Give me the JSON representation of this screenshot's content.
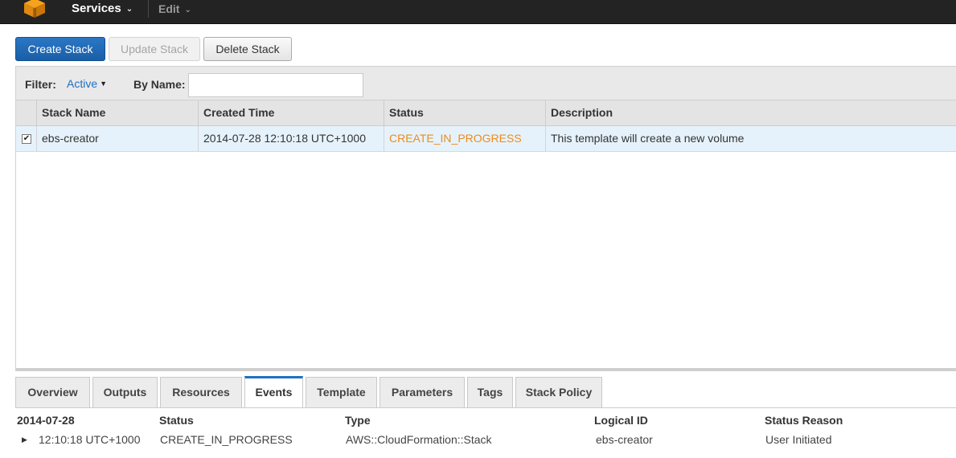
{
  "nav": {
    "services_label": "Services",
    "edit_label": "Edit",
    "logo_color": "#f7a21b"
  },
  "actions": {
    "create_label": "Create Stack",
    "update_label": "Update Stack",
    "delete_label": "Delete Stack"
  },
  "filter": {
    "label": "Filter:",
    "value": "Active",
    "by_name_label": "By Name:",
    "by_name_value": ""
  },
  "stacks_table": {
    "columns": [
      "Stack Name",
      "Created Time",
      "Status",
      "Description"
    ],
    "rows": [
      {
        "selected": true,
        "name": "ebs-creator",
        "created": "2014-07-28 12:10:18 UTC+1000",
        "status": "CREATE_IN_PROGRESS",
        "description": "This template will create a new volume"
      }
    ]
  },
  "tabs": [
    "Overview",
    "Outputs",
    "Resources",
    "Events",
    "Template",
    "Parameters",
    "Tags",
    "Stack Policy"
  ],
  "active_tab": "Events",
  "events": {
    "date_header": "2014-07-28",
    "columns": [
      "Status",
      "Type",
      "Logical ID",
      "Status Reason"
    ],
    "rows": [
      {
        "time": "12:10:18 UTC+1000",
        "status": "CREATE_IN_PROGRESS",
        "type": "AWS::CloudFormation::Stack",
        "logical_id": "ebs-creator",
        "reason": "User Initiated"
      }
    ]
  },
  "colors": {
    "primary_blue": "#1f6fc4",
    "status_orange": "#ec8c1a",
    "topbar": "#232323"
  }
}
